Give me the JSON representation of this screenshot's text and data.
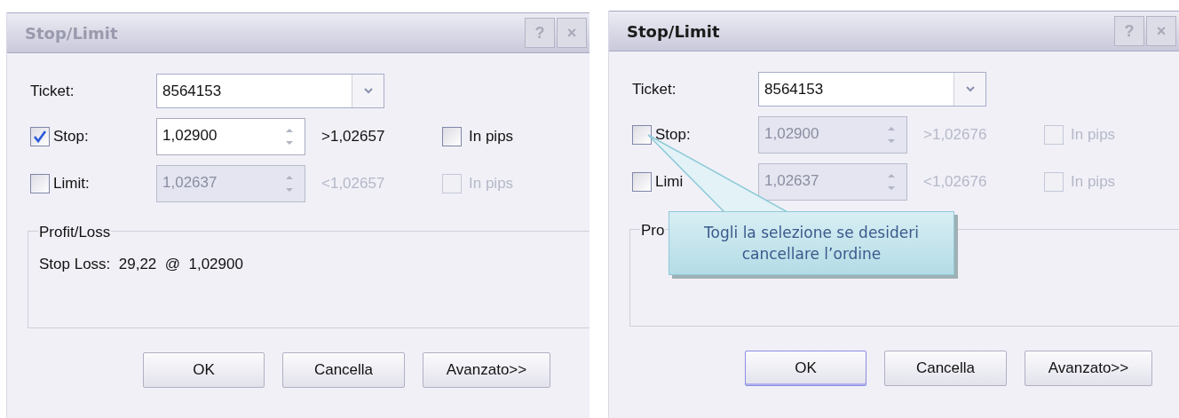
{
  "dialogs": [
    {
      "title": "Stop/Limit",
      "active": false,
      "title_buttons": [
        "?",
        "×"
      ],
      "ticket": {
        "label": "Ticket:",
        "value": "8564153"
      },
      "orders": [
        {
          "label": "Stop:",
          "checked": true,
          "value": "1,02900",
          "bound": ">1,02657",
          "pips": {
            "label": "In pips",
            "checked": false
          }
        },
        {
          "label": "Limit:",
          "checked": false,
          "value": "1,02637",
          "bound": "<1,02657",
          "pips": {
            "label": "In pips",
            "checked": false
          }
        }
      ],
      "group": {
        "title": "Profit/Loss",
        "lines": [
          "Stop Loss:  29,22  @  1,02900"
        ]
      },
      "buttons": [
        {
          "label": "OK",
          "default": false
        },
        {
          "label": "Cancella",
          "default": false
        },
        {
          "label": "Avanzato>>",
          "default": false
        }
      ]
    },
    {
      "title": "Stop/Limit",
      "active": true,
      "title_buttons": [
        "?",
        "×"
      ],
      "ticket": {
        "label": "Ticket:",
        "value": "8564153"
      },
      "orders": [
        {
          "label": "Stop:",
          "checked": false,
          "value": "1,02900",
          "bound": ">1,02676",
          "pips": {
            "label": "In pips",
            "checked": false
          }
        },
        {
          "label": "Limi",
          "checked": false,
          "value": "1,02637",
          "bound": "<1,02676",
          "pips": {
            "label": "In pips",
            "checked": false
          }
        }
      ],
      "group": {
        "title": "Pro"
      },
      "buttons": [
        {
          "label": "OK",
          "default": true
        },
        {
          "label": "Cancella",
          "default": false
        },
        {
          "label": "Avanzato>>",
          "default": false
        }
      ]
    }
  ],
  "tooltip": {
    "text": "Togli la selezione se desideri cancellare l’ordine"
  }
}
